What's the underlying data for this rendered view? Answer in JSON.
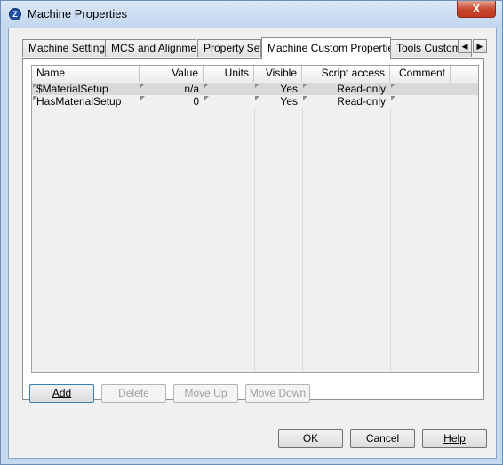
{
  "window": {
    "title": "Machine Properties",
    "app_icon_glyph": "Z",
    "close_glyph": "X"
  },
  "tabs": [
    {
      "label": "Machine Settings"
    },
    {
      "label": "MCS and Alignment"
    },
    {
      "label": "Property Sets"
    },
    {
      "label": "Machine Custom Properties",
      "active": true
    },
    {
      "label": "Tools Custom P"
    }
  ],
  "tab_scroll": {
    "left_glyph": "◀",
    "right_glyph": "▶"
  },
  "grid": {
    "columns": [
      "Name",
      "Value",
      "Units",
      "Visible",
      "Script access",
      "Comment"
    ],
    "rows": [
      {
        "name": "$MaterialSetup",
        "value": "n/a",
        "units": "",
        "visible": "Yes",
        "script_access": "Read-only",
        "comment": ""
      },
      {
        "name": "HasMaterialSetup",
        "value": "0",
        "units": "",
        "visible": "Yes",
        "script_access": "Read-only",
        "comment": ""
      }
    ]
  },
  "actions": {
    "add": "Add",
    "delete": "Delete",
    "move_up": "Move Up",
    "move_down": "Move Down"
  },
  "dialog_buttons": {
    "ok": "OK",
    "cancel": "Cancel",
    "help": "Help"
  }
}
